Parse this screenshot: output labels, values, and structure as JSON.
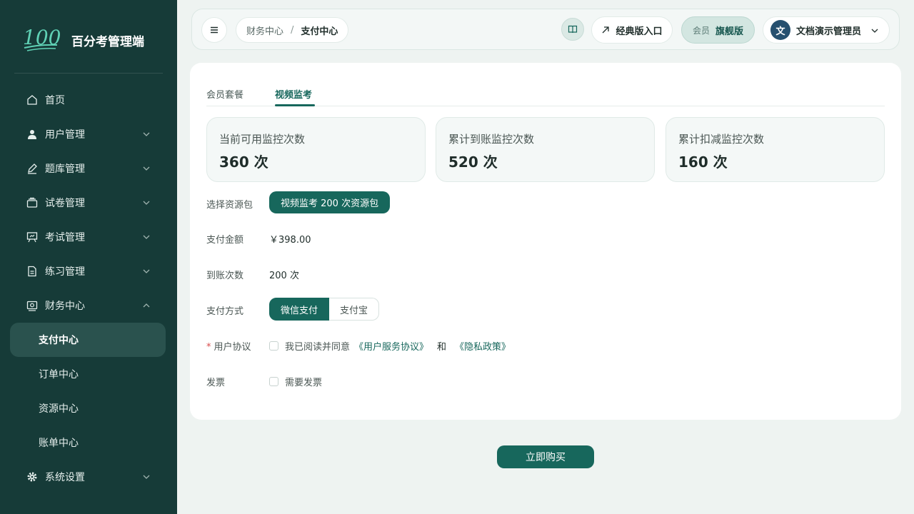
{
  "brand": {
    "logo_text": "100",
    "name": "百分考管理端"
  },
  "sidebar": {
    "items": [
      {
        "label": "首页",
        "icon": "home-icon",
        "expandable": false
      },
      {
        "label": "用户管理",
        "icon": "user-icon",
        "expandable": true
      },
      {
        "label": "题库管理",
        "icon": "edit-icon",
        "expandable": true
      },
      {
        "label": "试卷管理",
        "icon": "layers-icon",
        "expandable": true
      },
      {
        "label": "考试管理",
        "icon": "presentation-icon",
        "expandable": true
      },
      {
        "label": "练习管理",
        "icon": "document-icon",
        "expandable": true
      },
      {
        "label": "财务中心",
        "icon": "wallet-icon",
        "expandable": true,
        "expanded": true
      }
    ],
    "finance_sub": [
      {
        "label": "支付中心",
        "active": true
      },
      {
        "label": "订单中心",
        "active": false
      },
      {
        "label": "资源中心",
        "active": false
      },
      {
        "label": "账单中心",
        "active": false
      }
    ],
    "settings": {
      "label": "系统设置",
      "icon": "gear-icon"
    }
  },
  "topbar": {
    "breadcrumb": {
      "parent": "财务中心",
      "separator": "/",
      "current": "支付中心"
    },
    "classic_entry": "经典版入口",
    "member": {
      "prefix": "会员",
      "tier": "旗舰版"
    },
    "user": {
      "avatar": "文",
      "name": "文档演示管理员"
    }
  },
  "tabs": [
    {
      "label": "会员套餐",
      "active": false
    },
    {
      "label": "视频监考",
      "active": true
    }
  ],
  "stats": [
    {
      "label": "当前可用监控次数",
      "value": "360 次"
    },
    {
      "label": "累计到账监控次数",
      "value": "520 次"
    },
    {
      "label": "累计扣减监控次数",
      "value": "160 次"
    }
  ],
  "form": {
    "package_label": "选择资源包",
    "package_value": "视频监考 200 次资源包",
    "amount_label": "支付金额",
    "amount_value": "￥398.00",
    "count_label": "到账次数",
    "count_value": "200 次",
    "method_label": "支付方式",
    "method_options": [
      "微信支付",
      "支付宝"
    ],
    "agreement_label": "用户协议",
    "agreement_required": "*",
    "agreement_text": "我已阅读并同意",
    "agreement_link1": "《用户服务协议》",
    "agreement_and": "和",
    "agreement_link2": "《隐私政策》",
    "invoice_label": "发票",
    "invoice_text": "需要发票"
  },
  "buy_button": "立即购买",
  "colors": {
    "sidebar_bg": "#163b38",
    "accent": "#17675c",
    "page_bg": "#eef3f1"
  }
}
